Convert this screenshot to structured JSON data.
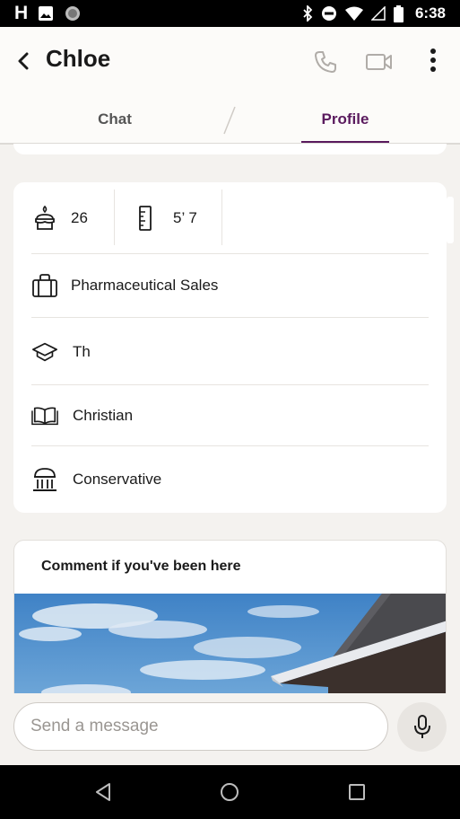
{
  "status_bar": {
    "time": "6:38",
    "left_icons": [
      "hinge-icon",
      "image-icon",
      "circle-icon"
    ],
    "right_icons": [
      "bluetooth-icon",
      "dnd-icon",
      "wifi-icon",
      "signal-icon",
      "battery-icon"
    ]
  },
  "header": {
    "name": "Chloe",
    "icons": [
      "back-icon",
      "phone-icon",
      "video-icon",
      "more-icon"
    ]
  },
  "tabs": [
    {
      "label": "Chat",
      "active": false
    },
    {
      "label": "Profile",
      "active": true
    }
  ],
  "profile": {
    "age": "26",
    "height": "5’ 7",
    "job": "Pharmaceutical Sales",
    "education": "Th",
    "religion": "Christian",
    "politics": "Conservative"
  },
  "photo_card": {
    "prompt": "Comment if you've been here"
  },
  "composer": {
    "placeholder": "Send a message"
  },
  "colors": {
    "accent": "#5a1a5e",
    "background": "#f4f2ef",
    "card": "#ffffff"
  }
}
